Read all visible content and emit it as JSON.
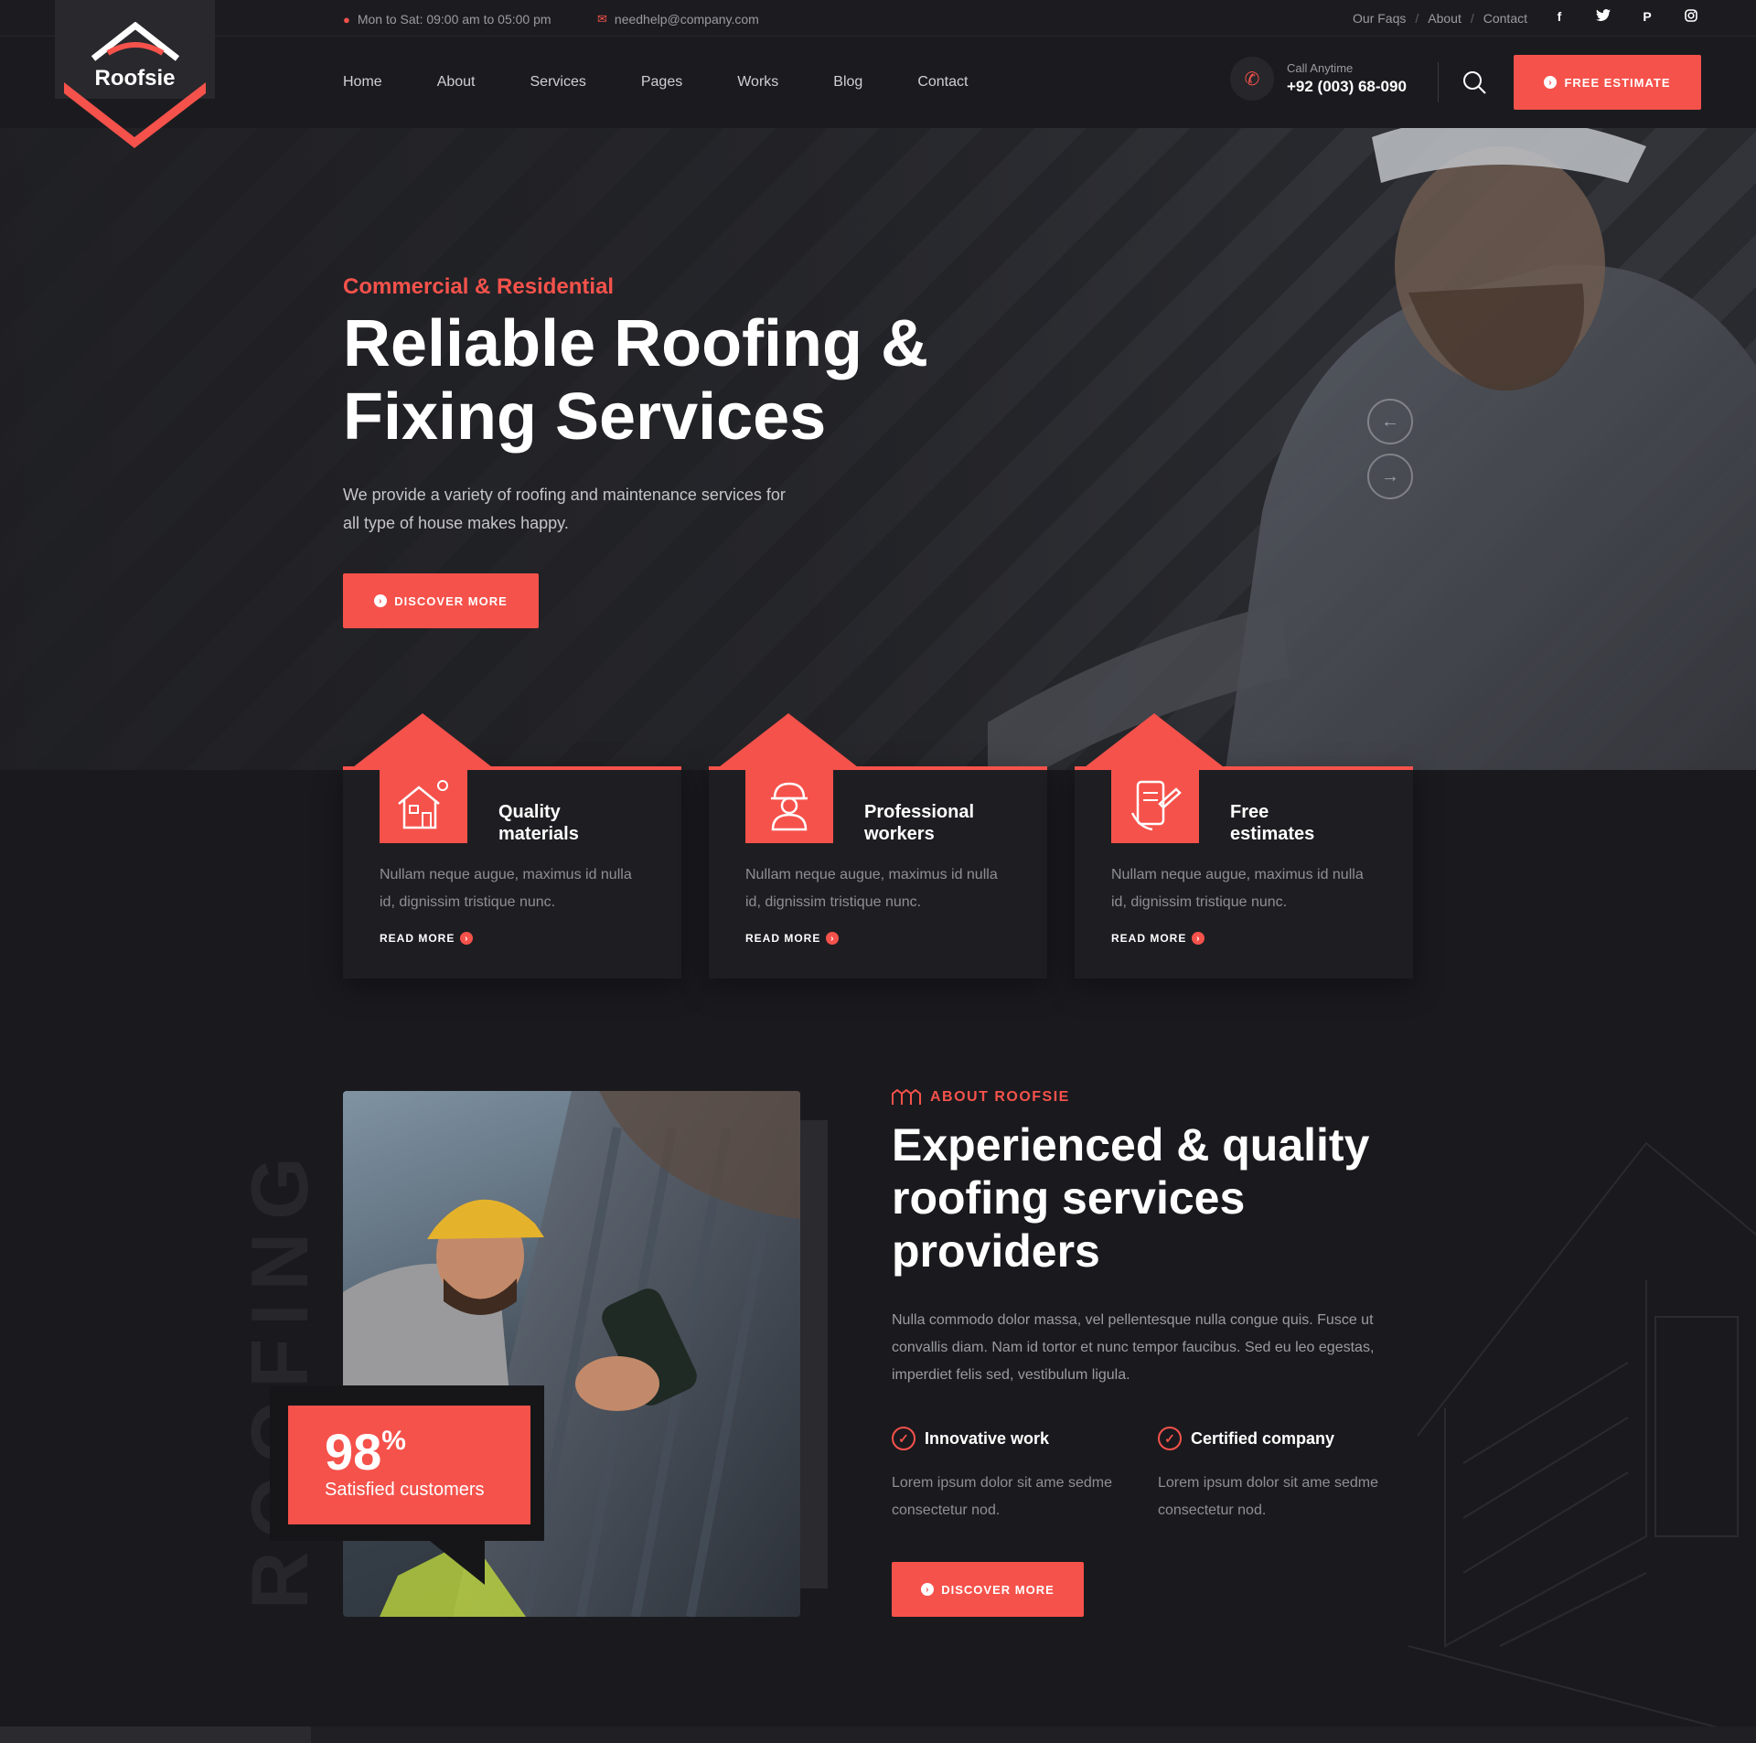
{
  "topbar": {
    "hours": "Mon to Sat: 09:00 am to 05:00 pm",
    "email": "needhelp@company.com",
    "links": [
      "Our Faqs",
      "About",
      "Contact"
    ],
    "separator": "/",
    "socials": [
      "facebook-icon",
      "twitter-icon",
      "pinterest-icon",
      "instagram-icon"
    ]
  },
  "header": {
    "logo": "Roofsie",
    "nav": [
      "Home",
      "About",
      "Services",
      "Pages",
      "Works",
      "Blog",
      "Contact"
    ],
    "call_label": "Call Anytime",
    "phone": "+92 (003) 68-090",
    "estimate_button": "FREE ESTIMATE"
  },
  "hero": {
    "subtitle": "Commercial & Residential",
    "title_line1": "Reliable Roofing &",
    "title_line2": "Fixing Services",
    "description_line1": "We provide a variety of roofing and maintenance services for",
    "description_line2": "all type of house makes happy.",
    "button": "DISCOVER MORE",
    "prev_arrow": "←",
    "next_arrow": "→"
  },
  "features": [
    {
      "title_line1": "Quality",
      "title_line2": "materials",
      "desc_line1": "Nullam neque augue, maximus id nulla",
      "desc_line2": "id, dignissim tristique nunc.",
      "link": "READ MORE",
      "icon": "house-icon"
    },
    {
      "title_line1": "Professional",
      "title_line2": "workers",
      "desc_line1": "Nullam neque augue, maximus id nulla",
      "desc_line2": "id, dignissim tristique nunc.",
      "link": "READ MORE",
      "icon": "worker-icon"
    },
    {
      "title_line1": "Free",
      "title_line2": "estimates",
      "desc_line1": "Nullam neque augue, maximus id nulla",
      "desc_line2": "id, dignissim tristique nunc.",
      "link": "READ MORE",
      "icon": "estimate-icon"
    }
  ],
  "about": {
    "vertical_word": "ROOFING",
    "tag": "ABOUT ROOFSIE",
    "title_line1": "Experienced & quality",
    "title_line2": "roofing services",
    "title_line3": "providers",
    "desc_line1": "Nulla commodo dolor massa, vel pellentesque nulla congue quis. Fusce ut",
    "desc_line2": "convallis diam. Nam id tortor et nunc tempor faucibus. Sed eu leo egestas,",
    "desc_line3": "imperdiet felis sed, vestibulum ligula.",
    "stat_number": "98",
    "stat_unit": "%",
    "stat_label": "Satisfied customers",
    "items": [
      {
        "title": "Innovative work",
        "desc_line1": "Lorem ipsum dolor sit ame sedme",
        "desc_line2": "consectetur nod."
      },
      {
        "title": "Certified company",
        "desc_line1": "Lorem ipsum dolor sit ame sedme",
        "desc_line2": "consectetur nod."
      }
    ],
    "button": "DISCOVER MORE"
  },
  "colors": {
    "accent": "#f5524b",
    "background": "#1a1a1e",
    "card": "#1e1e22"
  }
}
